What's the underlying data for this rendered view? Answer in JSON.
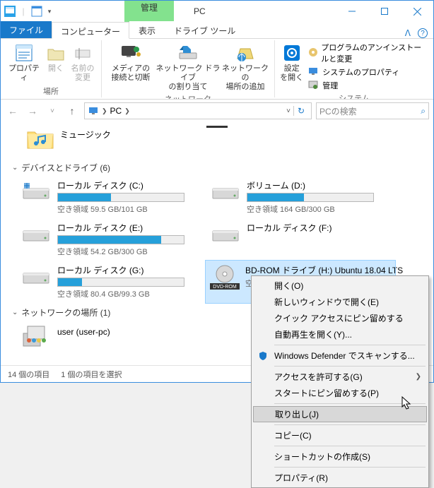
{
  "window": {
    "ctx_tab": "管理",
    "title": "PC"
  },
  "tabs": {
    "file": "ファイル",
    "computer": "コンピューター",
    "view": "表示",
    "drive_tools": "ドライブ ツール"
  },
  "ribbon": {
    "location": {
      "prop": "プロパティ",
      "open": "開く",
      "rename": "名前の\n変更",
      "group": "場所"
    },
    "network": {
      "media": "メディアの\n接続と切断",
      "map_drive": "ネットワーク ドライブ\nの割り当て",
      "add_loc": "ネットワークの\n場所の追加",
      "group": "ネットワーク"
    },
    "system": {
      "settings": "設定\nを開く",
      "uninstall": "プログラムのアンインストールと変更",
      "sysprops": "システムのプロパティ",
      "manage": "管理",
      "group": "システム"
    }
  },
  "breadcrumb": {
    "pc": "PC"
  },
  "search": {
    "placeholder": "PCの検索"
  },
  "content": {
    "music": "ミュージック",
    "devices_header": "デバイスとドライブ (6)",
    "network_header": "ネットワークの場所 (1)",
    "user_share": "user (user-pc)"
  },
  "drives": [
    {
      "label": "ローカル ディスク (C:)",
      "free": "空き領域 59.5 GB/101 GB",
      "pct": 42
    },
    {
      "label": "ボリューム (D:)",
      "free": "空き領域 164 GB/300 GB",
      "pct": 45
    },
    {
      "label": "ローカル ディスク (E:)",
      "free": "空き領域 54.2 GB/300 GB",
      "pct": 82
    },
    {
      "label": "ローカル ディスク (F:)",
      "free": "",
      "pct": -1
    },
    {
      "label": "ローカル ディスク (G:)",
      "free": "空き領域 80.4 GB/99.3 GB",
      "pct": 19
    },
    {
      "label": "BD-ROM ドライブ (H:) Ubuntu 18.04 LTS",
      "free": "空き領域",
      "pct": -1,
      "dvd": true
    }
  ],
  "statusbar": {
    "items": "14 個の項目",
    "selected": "1 個の項目を選択"
  },
  "context_menu": {
    "open": "開く(O)",
    "open_new": "新しいウィンドウで開く(E)",
    "pin_quick": "クイック アクセスにピン留めする",
    "autoplay": "自動再生を開く(Y)...",
    "defender": "Windows Defender でスキャンする...",
    "access": "アクセスを許可する(G)",
    "pin_start": "スタートにピン留めする(P)",
    "eject": "取り出し(J)",
    "copy": "コピー(C)",
    "shortcut": "ショートカットの作成(S)",
    "properties": "プロパティ(R)"
  }
}
